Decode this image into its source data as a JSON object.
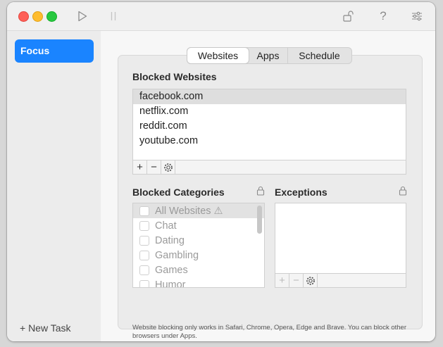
{
  "sidebar": {
    "items": [
      {
        "label": "Focus",
        "selected": true
      }
    ],
    "new_task_label": "+ New Task"
  },
  "tabs": [
    {
      "label": "Websites",
      "selected": true
    },
    {
      "label": "Apps",
      "selected": false
    },
    {
      "label": "Schedule",
      "selected": false
    }
  ],
  "blocked_websites": {
    "title": "Blocked Websites",
    "items": [
      "facebook.com",
      "netflix.com",
      "reddit.com",
      "youtube.com"
    ],
    "selected_index": 0
  },
  "blocked_categories": {
    "title": "Blocked Categories",
    "items": [
      {
        "label": "All Websites ⚠",
        "checked": false
      },
      {
        "label": "Chat",
        "checked": false
      },
      {
        "label": "Dating",
        "checked": false
      },
      {
        "label": "Gambling",
        "checked": false
      },
      {
        "label": "Games",
        "checked": false
      },
      {
        "label": "Humor",
        "checked": false
      }
    ]
  },
  "exceptions": {
    "title": "Exceptions",
    "items": []
  },
  "footnote": "Website blocking only works in Safari, Chrome, Opera, Edge and Brave. You can block other browsers under Apps.",
  "colors": {
    "accent": "#1a84ff",
    "close": "#fe5f57",
    "minimize": "#febc2e",
    "zoom": "#28c840"
  },
  "icons": {
    "play": "play-icon",
    "pause": "pause-icon",
    "lock": "lock-open-icon",
    "help": "help-icon",
    "settings": "sliders-icon",
    "gear": "gear-icon"
  }
}
